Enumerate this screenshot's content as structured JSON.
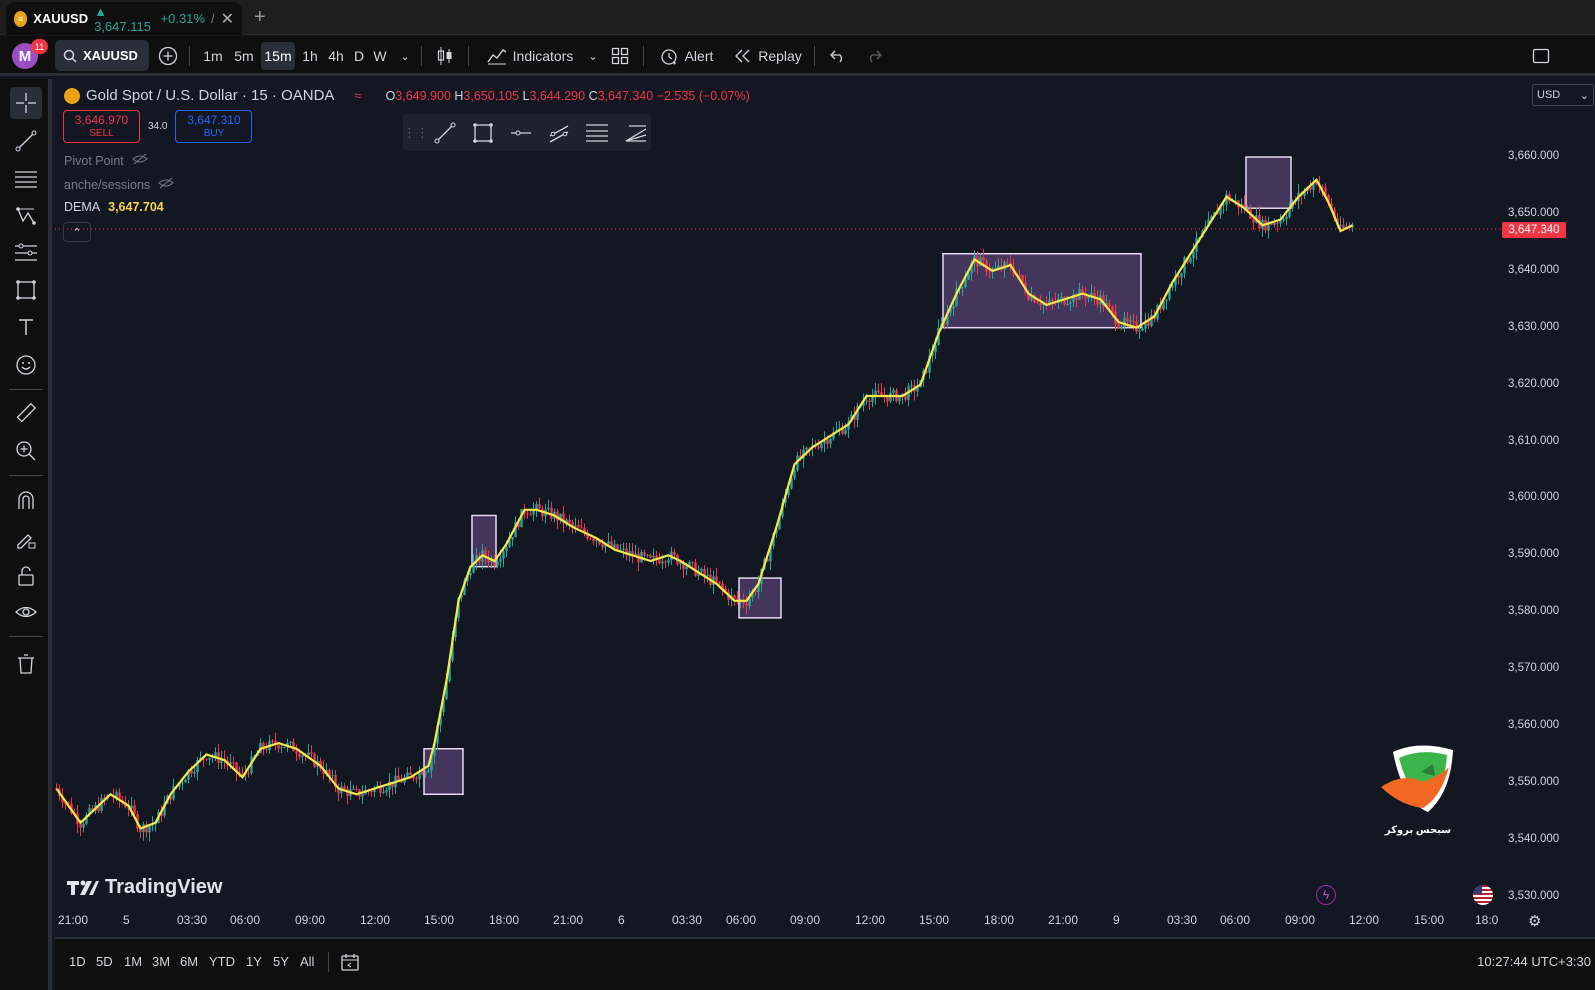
{
  "browser_tab": {
    "symbol": "XAUUSD",
    "price": "▲ 3,647.115",
    "change": "+0.31%",
    "separator": "/"
  },
  "toolbar": {
    "avatar_letter": "M",
    "notification_count": "11",
    "symbol": "XAUUSD",
    "timeframes": [
      "1m",
      "5m",
      "15m",
      "1h",
      "4h",
      "D",
      "W"
    ],
    "active_timeframe": "15m",
    "indicators_label": "Indicators",
    "alert_label": "Alert",
    "replay_label": "Replay"
  },
  "legend": {
    "title": "Gold Spot / U.S. Dollar · 15 · OANDA",
    "o_label": "O",
    "o_value": "3,649.900",
    "h_label": "H",
    "h_value": "3,650.105",
    "l_label": "L",
    "l_value": "3,644.290",
    "c_label": "C",
    "c_value": "3,647.340",
    "change": "−2.535 (−0.07%)"
  },
  "trade": {
    "sell_price": "3,646.970",
    "sell_label": "SELL",
    "spread": "34.0",
    "buy_price": "3,647.310",
    "buy_label": "BUY"
  },
  "indicators": {
    "pivot": "Pivot Point",
    "sessions": "anche/sessions",
    "dema_label": "DEMA",
    "dema_value": "3,647.704"
  },
  "price_scale": {
    "currency": "USD",
    "current_price_label": "3,647.340",
    "labels": [
      "3,660.000",
      "3,650.000",
      "3,640.000",
      "3,630.000",
      "3,620.000",
      "3,610.000",
      "3,600.000",
      "3,590.000",
      "3,580.000",
      "3,570.000",
      "3,560.000",
      "3,550.000",
      "3,540.000",
      "3,530.000"
    ]
  },
  "time_scale": {
    "labels": [
      "21:00",
      "5",
      "03:30",
      "06:00",
      "09:00",
      "12:00",
      "15:00",
      "18:00",
      "21:00",
      "6",
      "03:30",
      "06:00",
      "09:00",
      "12:00",
      "15:00",
      "18:00",
      "21:00",
      "9",
      "03:30",
      "06:00",
      "09:00",
      "12:00",
      "15:00",
      "18:0"
    ]
  },
  "watermark": {
    "tradingview": "TradingView",
    "broker_text": "سبحس بروکر"
  },
  "bottom_bar": {
    "ranges": [
      "1D",
      "5D",
      "1M",
      "3M",
      "6M",
      "YTD",
      "1Y",
      "5Y",
      "All"
    ],
    "clock": "10:27:44 UTC+3:30"
  },
  "colors": {
    "background": "#131722",
    "up": "#26a69a",
    "down": "#f23645",
    "dema": "#f7e84a",
    "box_fill": "#6b4f8a",
    "box_stroke": "#e8d8f5"
  },
  "chart_data": {
    "type": "candlestick",
    "symbol": "XAUUSD",
    "interval": "15",
    "ylim": [
      3525,
      3666
    ],
    "current_price": 3647.34,
    "path_points": [
      [
        0,
        3549
      ],
      [
        4,
        3546
      ],
      [
        8,
        3543
      ],
      [
        12,
        3545
      ],
      [
        18,
        3548
      ],
      [
        24,
        3546
      ],
      [
        28,
        3542
      ],
      [
        33,
        3543
      ],
      [
        38,
        3548
      ],
      [
        44,
        3552
      ],
      [
        50,
        3555
      ],
      [
        56,
        3554
      ],
      [
        62,
        3551
      ],
      [
        68,
        3556
      ],
      [
        74,
        3557
      ],
      [
        80,
        3556
      ],
      [
        88,
        3553
      ],
      [
        94,
        3549
      ],
      [
        100,
        3548
      ],
      [
        106,
        3549
      ],
      [
        112,
        3550
      ],
      [
        118,
        3551
      ],
      [
        124,
        3553
      ],
      [
        126,
        3557
      ],
      [
        130,
        3568
      ],
      [
        134,
        3582
      ],
      [
        138,
        3588
      ],
      [
        142,
        3590
      ],
      [
        146,
        3589
      ],
      [
        150,
        3592
      ],
      [
        156,
        3598
      ],
      [
        160,
        3598
      ],
      [
        166,
        3597
      ],
      [
        172,
        3595
      ],
      [
        180,
        3593
      ],
      [
        186,
        3591
      ],
      [
        192,
        3590
      ],
      [
        198,
        3589
      ],
      [
        204,
        3590
      ],
      [
        208,
        3589
      ],
      [
        214,
        3587
      ],
      [
        220,
        3585
      ],
      [
        226,
        3582
      ],
      [
        230,
        3582
      ],
      [
        234,
        3585
      ],
      [
        240,
        3595
      ],
      [
        246,
        3606
      ],
      [
        252,
        3609
      ],
      [
        258,
        3611
      ],
      [
        264,
        3613
      ],
      [
        270,
        3618
      ],
      [
        276,
        3618
      ],
      [
        282,
        3618
      ],
      [
        288,
        3620
      ],
      [
        294,
        3629
      ],
      [
        300,
        3636
      ],
      [
        306,
        3642
      ],
      [
        312,
        3640
      ],
      [
        318,
        3641
      ],
      [
        324,
        3636
      ],
      [
        330,
        3634
      ],
      [
        336,
        3635
      ],
      [
        342,
        3636
      ],
      [
        348,
        3635
      ],
      [
        354,
        3631
      ],
      [
        360,
        3630
      ],
      [
        366,
        3632
      ],
      [
        372,
        3638
      ],
      [
        378,
        3643
      ],
      [
        384,
        3648
      ],
      [
        390,
        3653
      ],
      [
        396,
        3651
      ],
      [
        402,
        3648
      ],
      [
        408,
        3649
      ],
      [
        414,
        3653
      ],
      [
        420,
        3656
      ],
      [
        424,
        3652
      ],
      [
        428,
        3647
      ],
      [
        432,
        3648
      ]
    ],
    "highlight_boxes": [
      {
        "x0": 123,
        "x1": 136,
        "y0": 3548,
        "y1": 3556
      },
      {
        "x0": 139,
        "x1": 147,
        "y0": 3588,
        "y1": 3597
      },
      {
        "x0": 228,
        "x1": 242,
        "y0": 3579,
        "y1": 3586
      },
      {
        "x0": 296,
        "x1": 362,
        "y0": 3630,
        "y1": 3643
      },
      {
        "x0": 397,
        "x1": 412,
        "y0": 3651,
        "y1": 3660
      }
    ]
  }
}
